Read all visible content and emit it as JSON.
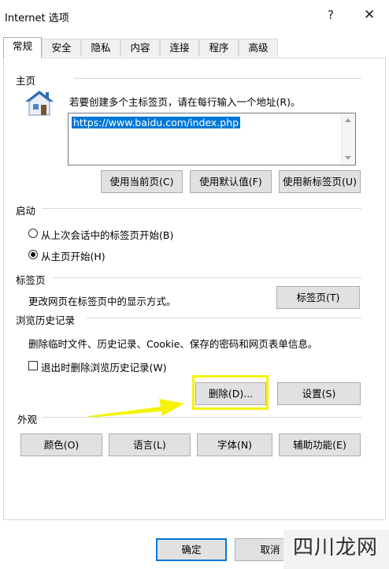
{
  "window": {
    "title": "Internet 选项",
    "help_glyph": "?",
    "close_glyph": "✕"
  },
  "tabs": [
    {
      "label": "常规",
      "active": true
    },
    {
      "label": "安全"
    },
    {
      "label": "隐私"
    },
    {
      "label": "内容"
    },
    {
      "label": "连接"
    },
    {
      "label": "程序"
    },
    {
      "label": "高级"
    }
  ],
  "homepage": {
    "group_label": "主页",
    "description": "若要创建多个主标签页，请在每行输入一个地址(R)。",
    "url_value": "https://www.baidu.com/index.php",
    "buttons": {
      "use_current": "使用当前页(C)",
      "use_default": "使用默认值(F)",
      "use_new_tab": "使用新标签页(U)"
    }
  },
  "startup": {
    "group_label": "启动",
    "option_last_session": "从上次会话中的标签页开始(B)",
    "option_homepage": "从主页开始(H)",
    "selected": "option_homepage"
  },
  "tabs_section": {
    "group_label": "标签页",
    "description": "更改网页在标签页中的显示方式。",
    "button": "标签页(T)"
  },
  "history": {
    "group_label": "浏览历史记录",
    "description": "删除临时文件、历史记录、Cookie、保存的密码和网页表单信息。",
    "checkbox_label": "退出时删除浏览历史记录(W)",
    "checkbox_checked": false,
    "delete_button": "删除(D)...",
    "settings_button": "设置(S)"
  },
  "appearance": {
    "group_label": "外观",
    "colors_button": "颜色(O)",
    "languages_button": "语言(L)",
    "fonts_button": "字体(N)",
    "accessibility_button": "辅助功能(E)"
  },
  "footer": {
    "ok_button": "确定",
    "cancel_button": "取消"
  },
  "annotation": {
    "highlight_color": "#f5f20a",
    "arrow_color": "#f5f20a"
  },
  "watermark": {
    "text": "四川龙网"
  }
}
